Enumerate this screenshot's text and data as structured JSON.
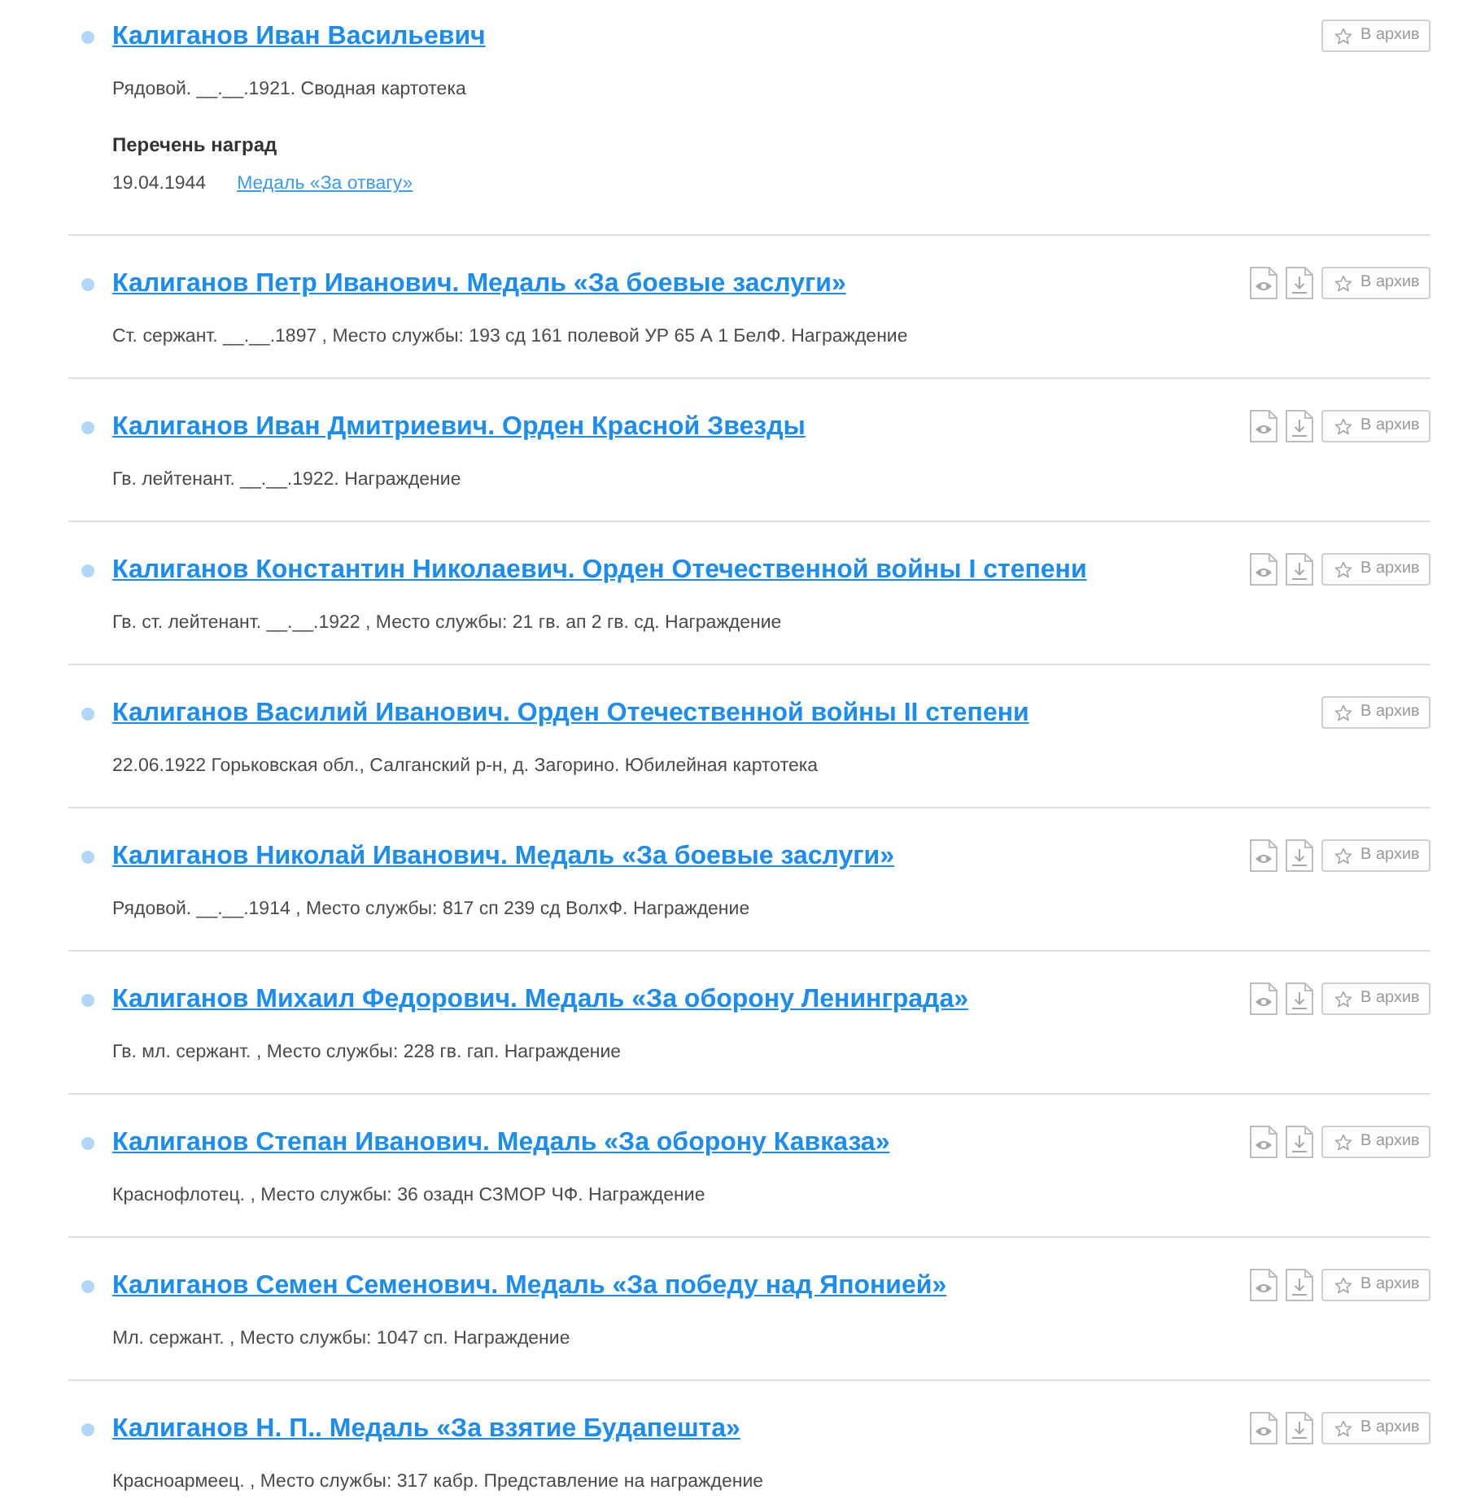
{
  "records": [
    {
      "title": "Калиганов Иван Васильевич",
      "description": "Рядовой. __.__.1921. Сводная картотека",
      "awards": {
        "heading": "Перечень наград",
        "items": [
          {
            "date": "19.04.1944",
            "name": "Медаль «За отвагу»"
          }
        ]
      },
      "document_icons": false,
      "archive_button": "В архив"
    },
    {
      "title": "Калиганов Петр Иванович. Медаль «За боевые заслуги»",
      "description": "Ст. сержант. __.__.1897 , Место службы: 193 сд 161 полевой УР 65 А 1 БелФ. Награждение",
      "document_icons": true,
      "archive_button": "В архив"
    },
    {
      "title": "Калиганов Иван Дмитриевич. Орден Красной Звезды",
      "description": "Гв. лейтенант. __.__.1922. Награждение",
      "document_icons": true,
      "archive_button": "В архив"
    },
    {
      "title": "Калиганов Константин Николаевич. Орден Отечественной войны I степени",
      "description": "Гв. ст. лейтенант. __.__.1922 , Место службы: 21 гв. ап 2 гв. сд. Награждение",
      "document_icons": true,
      "archive_button": "В архив"
    },
    {
      "title": "Калиганов Василий Иванович. Орден Отечественной войны II степени",
      "description": "22.06.1922 Горьковская обл., Салганский р-н, д. Загорино. Юбилейная картотека",
      "document_icons": false,
      "archive_button": "В архив"
    },
    {
      "title": "Калиганов Николай Иванович. Медаль «За боевые заслуги»",
      "description": "Рядовой. __.__.1914 , Место службы: 817 сп 239 сд ВолхФ. Награждение",
      "document_icons": true,
      "archive_button": "В архив"
    },
    {
      "title": "Калиганов Михаил Федорович. Медаль «За оборону Ленинграда»",
      "description": "Гв. мл. сержант. , Место службы: 228 гв. гап. Награждение",
      "document_icons": true,
      "archive_button": "В архив"
    },
    {
      "title": "Калиганов Степан Иванович. Медаль «За оборону Кавказа»",
      "description": "Краснофлотец. , Место службы: 36 озадн СЗМОР ЧФ. Награждение",
      "document_icons": true,
      "archive_button": "В архив"
    },
    {
      "title": "Калиганов Семен Семенович. Медаль «За победу над Японией»",
      "description": "Мл. сержант. , Место службы: 1047 сп. Награждение",
      "document_icons": true,
      "archive_button": "В архив"
    },
    {
      "title": "Калиганов Н. П.. Медаль «За взятие Будапешта»",
      "description": "Красноармеец. , Место службы: 317 кабр. Представление на награждение",
      "document_icons": true,
      "archive_button": "В архив"
    }
  ]
}
